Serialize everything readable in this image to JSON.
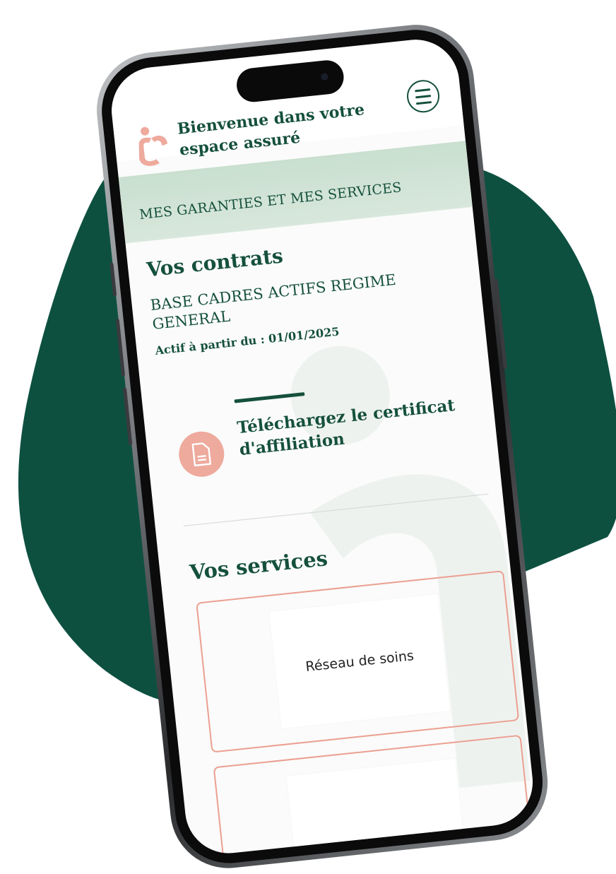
{
  "header": {
    "welcome_line1": "Bienvenue dans votre",
    "welcome_line2": "espace assuré",
    "logo_icon": "brand-logo-icon",
    "menu_icon": "hamburger-menu-icon"
  },
  "banner": {
    "title": "MES GARANTIES ET MES SERVICES"
  },
  "contracts": {
    "title": "Vos contrats",
    "name": "BASE CADRES ACTIFS REGIME GENERAL",
    "active_from": "Actif à partir du : 01/01/2025",
    "certificate_label": "Téléchargez le certificat d'affiliation",
    "certificate_icon": "document-icon"
  },
  "services": {
    "title": "Vos services",
    "items": [
      {
        "label": "Réseau de soins"
      },
      {
        "label": ""
      }
    ]
  },
  "colors": {
    "brand_green": "#15503c",
    "blob_green": "#0d5040",
    "banner_green": "#c9dfcf",
    "accent_salmon": "#eeaa9d",
    "card_border": "#ec9f91"
  }
}
